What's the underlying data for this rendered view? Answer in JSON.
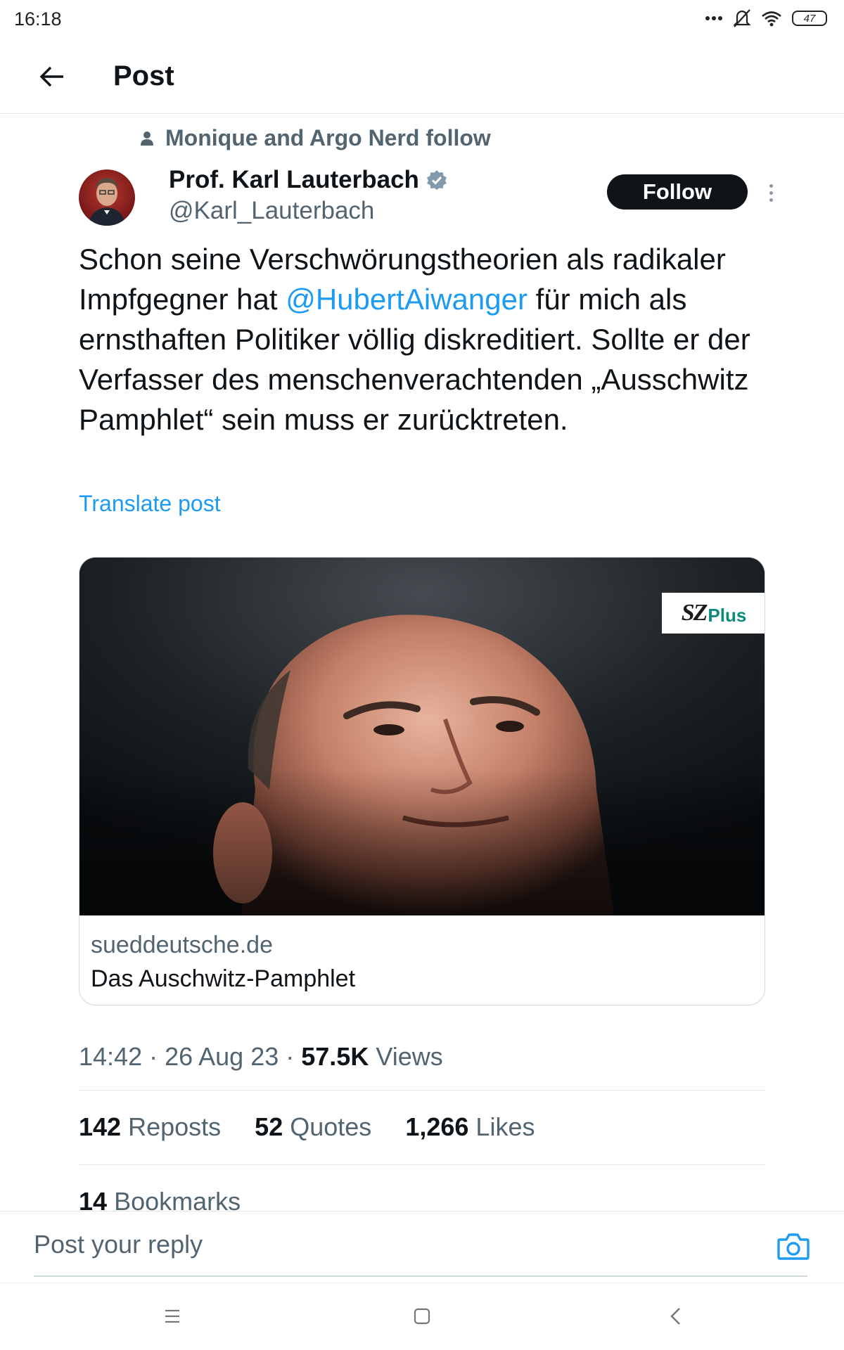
{
  "status_bar": {
    "time": "16:18",
    "battery": "47",
    "icons": [
      "more-dots-icon",
      "bell-muted-icon",
      "wifi-icon",
      "battery-icon"
    ]
  },
  "header": {
    "title": "Post",
    "back_icon": "arrow-left-icon"
  },
  "social_context": {
    "text": "Monique and Argo Nerd follow",
    "icon": "person-icon"
  },
  "author": {
    "name": "Prof. Karl Lauterbach",
    "handle": "@Karl_Lauterbach",
    "verified": true,
    "follow_label": "Follow"
  },
  "tweet": {
    "text_before": "Schon seine Verschwörungstheorien als radikaler Impfgegner hat ",
    "mention": "@HubertAiwanger",
    "text_after": " für mich als ernsthaften Politiker völlig diskreditiert. Sollte er der Verfasser des menschenverachtenden „Ausschwitz Pamphlet“ sein muss er zurücktreten.",
    "translate_label": "Translate post"
  },
  "card": {
    "badge_logo": "SZ",
    "badge_plus": "Plus",
    "domain": "sueddeutsche.de",
    "title": "Das Auschwitz-Pamphlet"
  },
  "meta": {
    "time": "14:42",
    "date": "26 Aug 23",
    "views_count": "57.5K",
    "views_label": "Views"
  },
  "stats": {
    "reposts_count": "142",
    "reposts_label": "Reposts",
    "quotes_count": "52",
    "quotes_label": "Quotes",
    "likes_count": "1,266",
    "likes_label": "Likes",
    "bookmarks_count": "14",
    "bookmarks_label": "Bookmarks"
  },
  "reply": {
    "placeholder": "Post your reply",
    "camera_icon": "camera-icon"
  },
  "colors": {
    "accent": "#1d9bf0",
    "text_primary": "#0f1419",
    "text_secondary": "#536471",
    "border": "#cfd9de"
  }
}
